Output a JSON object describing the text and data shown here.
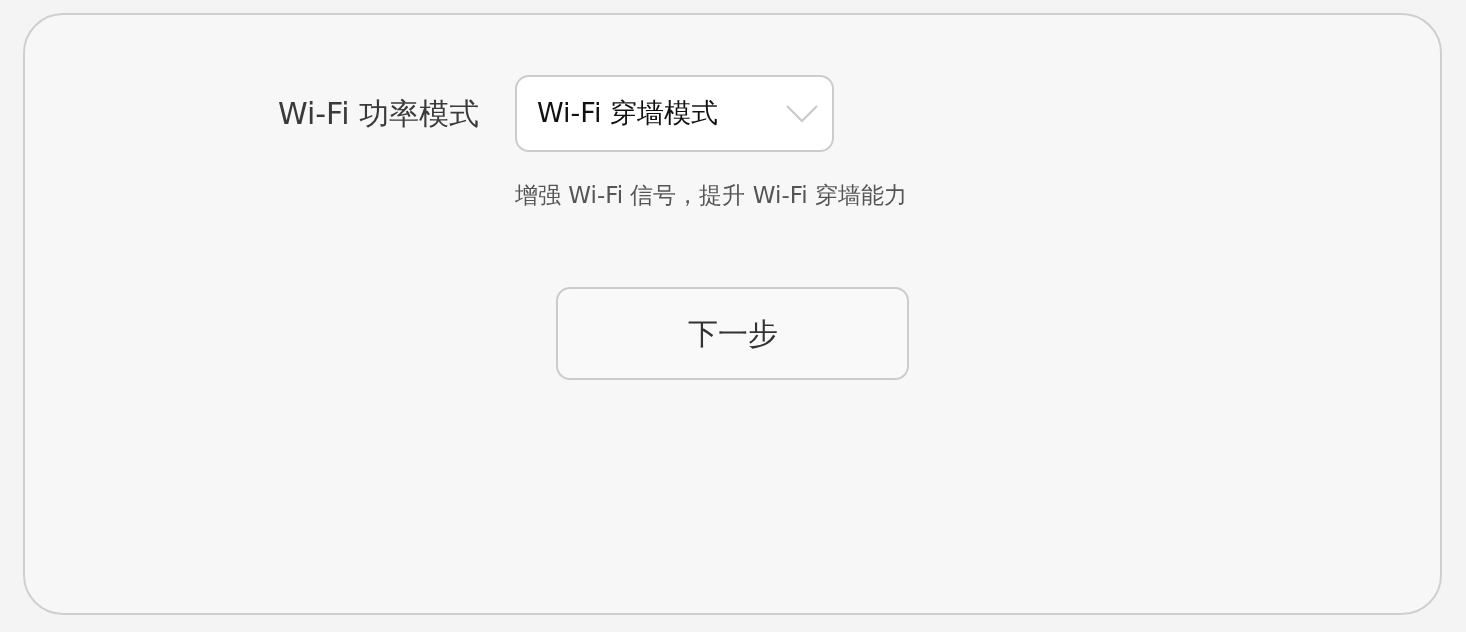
{
  "form": {
    "label": "Wi-Fi 功率模式",
    "select": {
      "value": "Wi-Fi 穿墙模式"
    },
    "hint": "增强 Wi-Fi 信号，提升 Wi-Fi 穿墙能力"
  },
  "buttons": [
    {
      "label": "下一步"
    }
  ]
}
